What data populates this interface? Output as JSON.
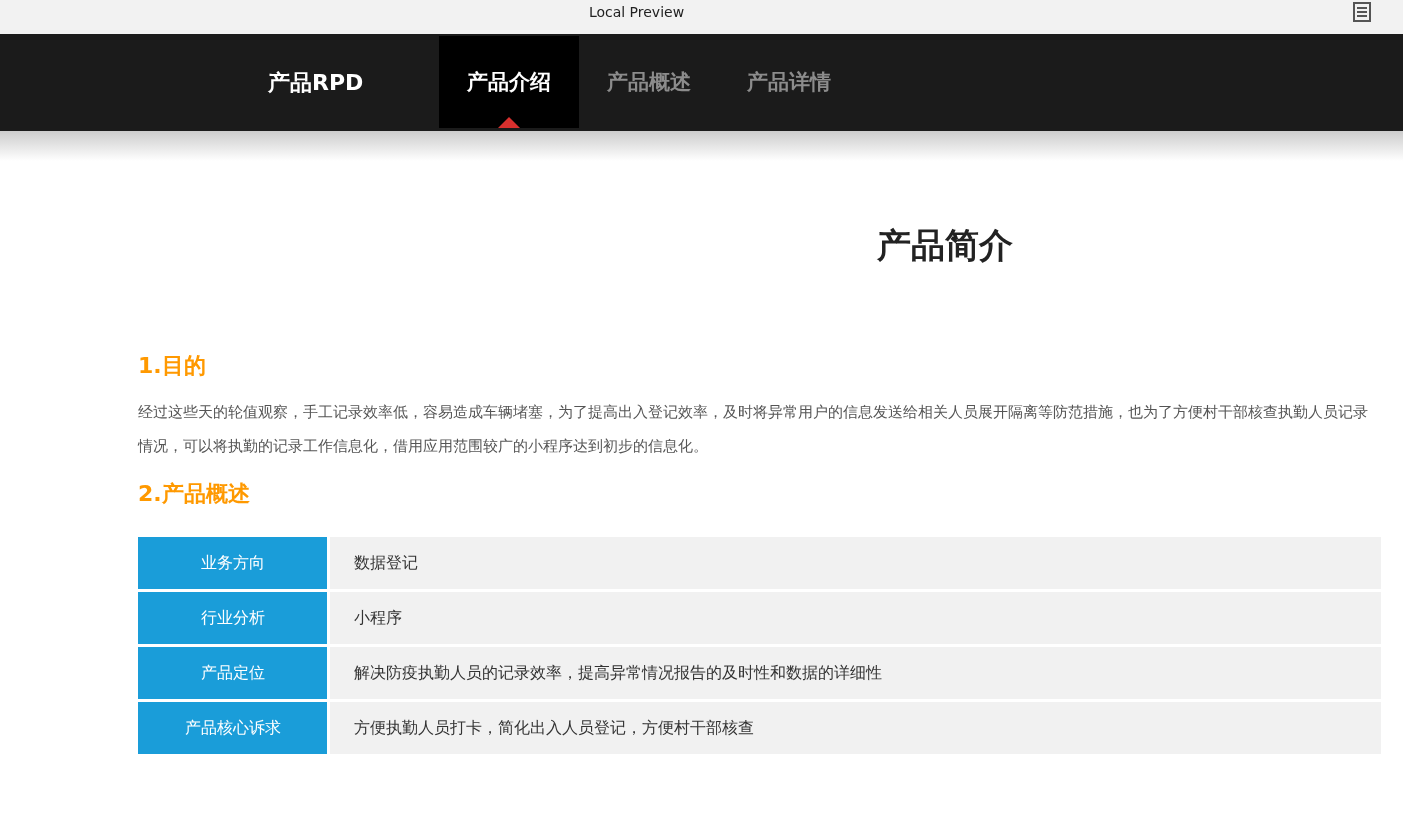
{
  "window": {
    "title": "Local Preview"
  },
  "nav": {
    "brand": "产品RPD",
    "tabs": [
      {
        "label": "产品介绍",
        "selected": true
      },
      {
        "label": "产品概述",
        "selected": false
      },
      {
        "label": "产品详情",
        "selected": false
      }
    ]
  },
  "page_title": "产品简介",
  "sections": [
    {
      "heading": "1.目的",
      "paragraph": "经过这些天的轮值观察，手工记录效率低，容易造成车辆堵塞，为了提高出入登记效率，及时将异常用户的信息发送给相关人员展开隔离等防范措施，也为了方便村干部核查执勤人员记录情况，可以将执勤的记录工作信息化，借用应用范围较广的小程序达到初步的信息化。"
    },
    {
      "heading": "2.产品概述",
      "table": [
        {
          "label": "业务方向",
          "value": "数据登记"
        },
        {
          "label": "行业分析",
          "value": "小程序"
        },
        {
          "label": "产品定位",
          "value": "解决防疫执勤人员的记录效率，提高异常情况报告的及时性和数据的详细性"
        },
        {
          "label": "产品核心诉求",
          "value": "方便执勤人员打卡，简化出入人员登记，方便村干部核查"
        }
      ]
    }
  ]
}
